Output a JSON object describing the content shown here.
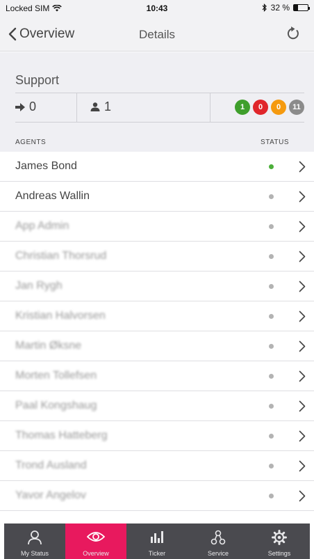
{
  "status_bar": {
    "carrier": "Locked SIM",
    "time": "10:43",
    "battery_text": "32 %",
    "battery_level": 0.32
  },
  "nav": {
    "back_label": "Overview",
    "title": "Details"
  },
  "summary": {
    "queue_name": "Support",
    "transfers": "0",
    "agents_logged_in": "1",
    "badges": [
      {
        "value": "1",
        "color": "#3f9f2c"
      },
      {
        "value": "0",
        "color": "#e0262b"
      },
      {
        "value": "0",
        "color": "#f59a0f"
      },
      {
        "value": "11",
        "color": "#8b8b8b"
      }
    ]
  },
  "table": {
    "col_agents": "AGENTS",
    "col_status": "STATUS"
  },
  "agents": [
    {
      "name": "James Bond",
      "status_color": "#4caf3a"
    },
    {
      "name": "Andreas Wallin",
      "status_color": "#b3b3b3"
    },
    {
      "name": "App Admin",
      "status_color": "#b3b3b3"
    },
    {
      "name": "Christian Thorsrud",
      "status_color": "#b3b3b3"
    },
    {
      "name": "Jan Rygh",
      "status_color": "#b3b3b3"
    },
    {
      "name": "Kristian Halvorsen",
      "status_color": "#b3b3b3"
    },
    {
      "name": "Martin Øksne",
      "status_color": "#b3b3b3"
    },
    {
      "name": "Morten Tollefsen",
      "status_color": "#b3b3b3"
    },
    {
      "name": "Paal Kongshaug",
      "status_color": "#b3b3b3"
    },
    {
      "name": "Thomas Hatteberg",
      "status_color": "#b3b3b3"
    },
    {
      "name": "Trond Ausland",
      "status_color": "#b3b3b3"
    },
    {
      "name": "Yavor Angelov",
      "status_color": "#b3b3b3"
    }
  ],
  "tabs": [
    {
      "label": "My Status",
      "icon": "person-icon"
    },
    {
      "label": "Overview",
      "icon": "eye-icon",
      "active": true
    },
    {
      "label": "Ticker",
      "icon": "bar-chart-icon"
    },
    {
      "label": "Service",
      "icon": "network-icon"
    },
    {
      "label": "Settings",
      "icon": "gear-icon"
    }
  ],
  "colors": {
    "accent": "#e8195e",
    "tabbar_bg": "#4a4a4f",
    "header_bg": "#efeff3"
  }
}
